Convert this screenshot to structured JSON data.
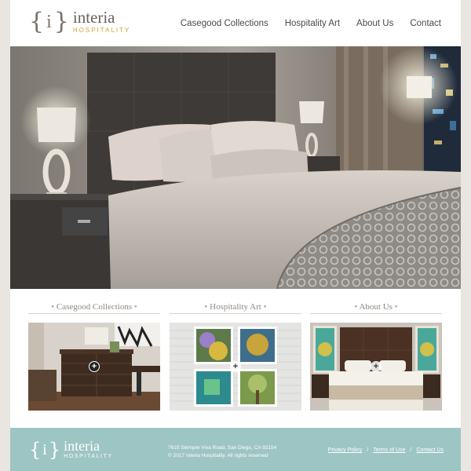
{
  "header": {
    "logo": {
      "brace_open": "{",
      "letter": "i",
      "brace_close": "}",
      "name": "interia",
      "tagline": "HOSPITALITY"
    },
    "nav": [
      "Casegood Collections",
      "Hospitality Art",
      "About Us",
      "Contact"
    ]
  },
  "sections": [
    {
      "dot_left": "•",
      "title": "Casegood Collections",
      "dot_right": "•"
    },
    {
      "dot_left": "•",
      "title": "Hospitality Art",
      "dot_right": "•"
    },
    {
      "dot_left": "•",
      "title": "About Us",
      "dot_right": "•"
    }
  ],
  "plus_glyph": "+",
  "footer": {
    "logo": {
      "brace_open": "{",
      "letter": "i",
      "brace_close": "}",
      "name": "interia",
      "tagline": "HOSPITALITY"
    },
    "address_line": "7615 Siempre Viva Road, San Diego, CA 92154",
    "copyright": "© 2017 Interia Hospitality. All rights reserved",
    "links": [
      "Privacy Policy",
      "Terms of Use",
      "Contact Us"
    ],
    "separator": "/"
  },
  "colors": {
    "accent_teal": "#9dc5c4",
    "gold": "#c9a634",
    "page_bg": "#e9e6e2"
  }
}
